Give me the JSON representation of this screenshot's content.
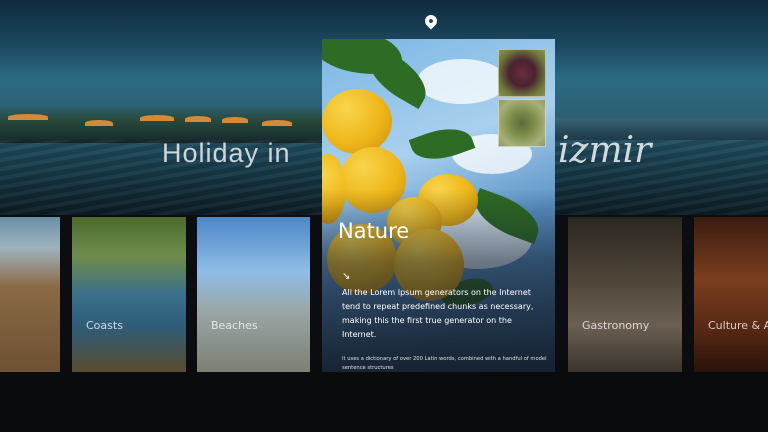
{
  "hero": {
    "title_left": "Holiday in",
    "title_right": "izmir"
  },
  "cards": {
    "coasts": "Coasts",
    "beaches": "Beaches",
    "gastronomy": "Gastronomy",
    "culture": "Culture & A"
  },
  "featured": {
    "title": "Nature",
    "description": "All the Lorem Ipsum generators on the Internet tend to repeat predefined chunks as necessary, making this the first true generator on the Internet.",
    "small_text": "It uses a dictionary of over 200 Latin words, combined with a handful of model sentence structures"
  },
  "icons": {
    "pin": "location-pin-icon",
    "arrow": "arrow-down-right-icon"
  },
  "colors": {
    "lemon": "#eeb619",
    "sky": "#7ab6e4"
  }
}
